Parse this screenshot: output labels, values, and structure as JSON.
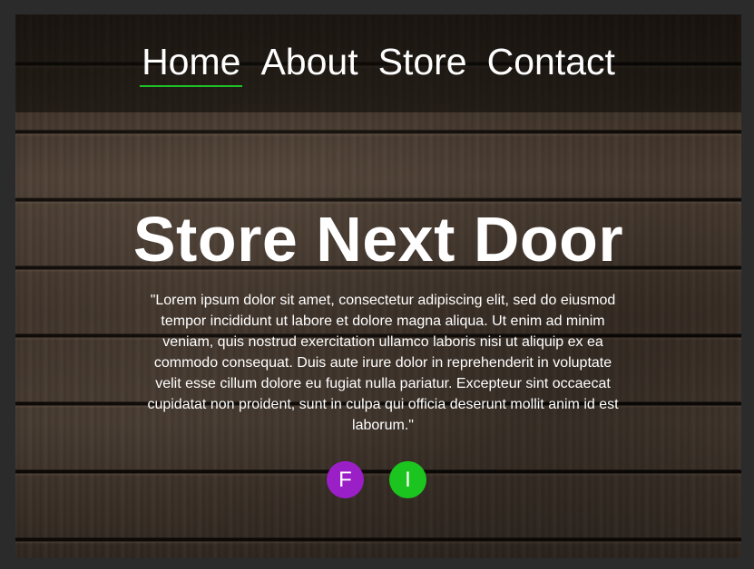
{
  "nav": {
    "items": [
      {
        "label": "Home",
        "active": true
      },
      {
        "label": "About",
        "active": false
      },
      {
        "label": "Store",
        "active": false
      },
      {
        "label": "Contact",
        "active": false
      }
    ],
    "active_underline_color": "#1fbf2a"
  },
  "hero": {
    "title": "Store Next Door",
    "text": "\"Lorem ipsum dolor sit amet, consectetur adipiscing elit, sed do eiusmod tempor incididunt ut labore et dolore magna aliqua. Ut enim ad minim veniam, quis nostrud exercitation ullamco laboris nisi ut aliquip ex ea commodo consequat. Duis aute irure dolor in reprehenderit in voluptate velit esse cillum dolore eu fugiat nulla pariatur. Excepteur sint occaecat cupidatat non proident, sunt in culpa qui officia deserunt mollit anim id est laborum.\""
  },
  "social": [
    {
      "label": "F",
      "color": "#9b1fc6"
    },
    {
      "label": "I",
      "color": "#1cc41f"
    }
  ]
}
